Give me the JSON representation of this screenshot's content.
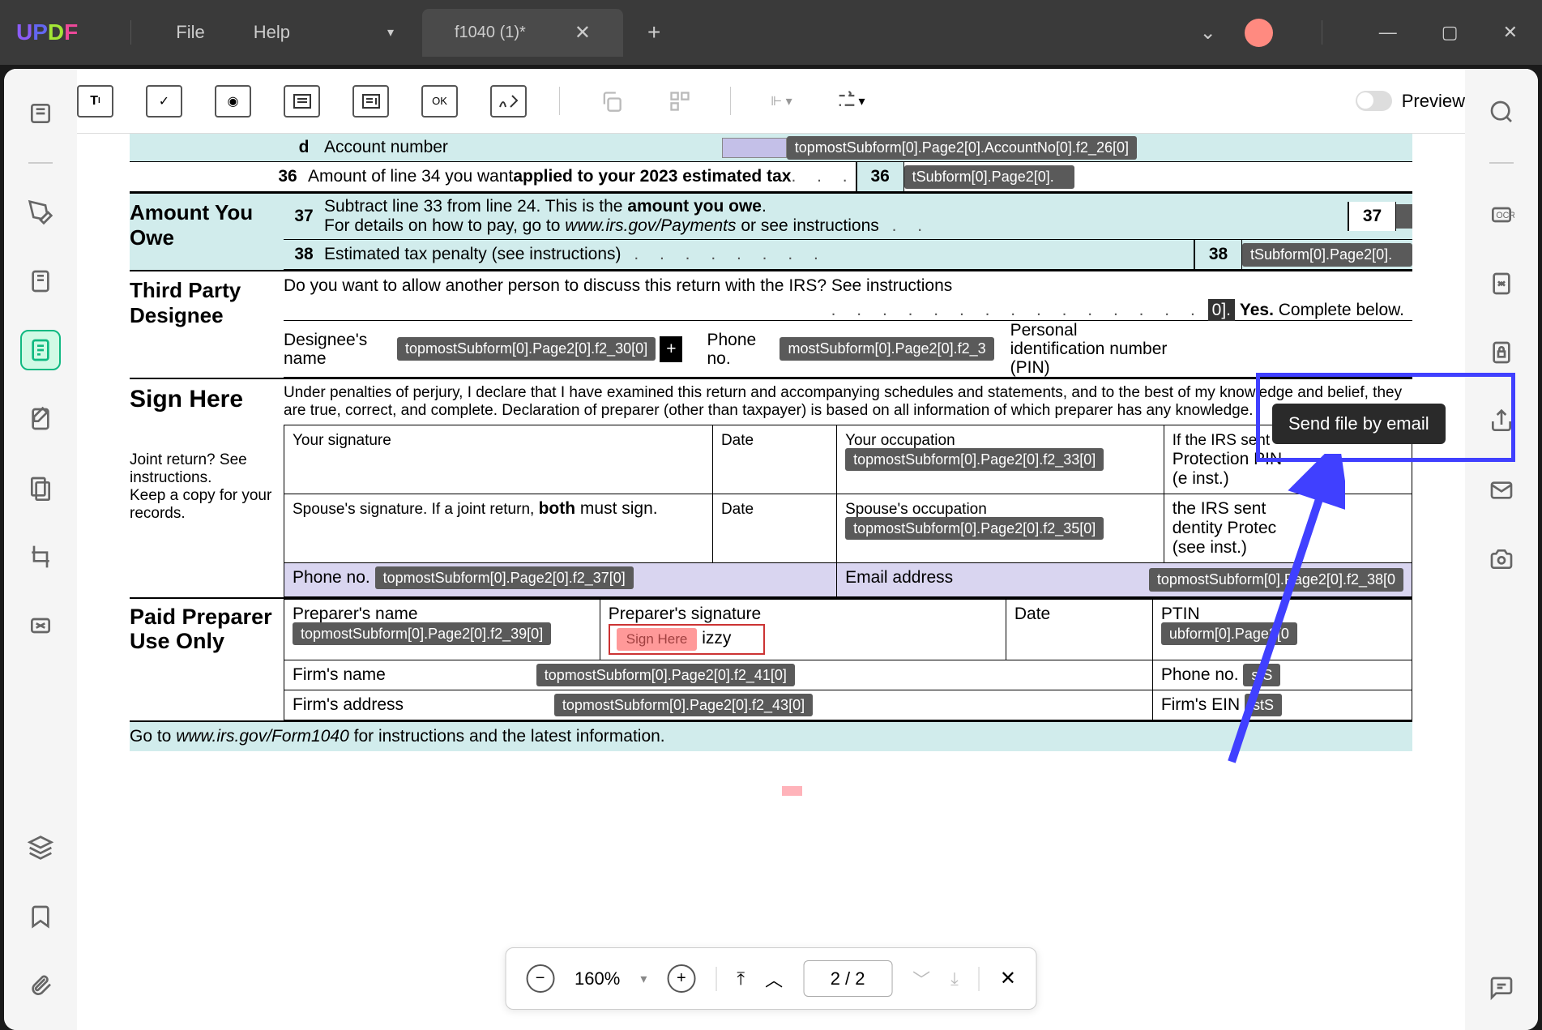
{
  "titlebar": {
    "menu_file": "File",
    "menu_help": "Help",
    "tab_title": "f1040 (1)*"
  },
  "toolbar": {
    "preview_label": "Preview",
    "ok_label": "OK",
    "text_label": "T"
  },
  "tooltip": {
    "send_email": "Send file by email"
  },
  "form": {
    "line_d": "d",
    "account_number": "Account number",
    "account_field": "topmostSubform[0].Page2[0].AccountNo[0].f2_26[0]",
    "line_36": "36",
    "line_36_text": "Amount of line 34 you want ",
    "line_36_bold": "applied to your 2023 estimated tax",
    "line_36_field": "tSubform[0].Page2[0].",
    "amount_you_owe": "Amount You Owe",
    "line_37": "37",
    "line_37_a": "Subtract line 33 from line 24. This is the ",
    "line_37_bold": "amount you owe",
    "line_37_b": ".",
    "line_37_c": "For details on how to pay, go to ",
    "line_37_url": "www.irs.gov/Payments",
    "line_37_d": " or see instructions",
    "line_38": "38",
    "line_38_text": "Estimated tax penalty (see instructions)",
    "line_38_field": "tSubform[0].Page2[0].",
    "third_party": "Third Party Designee",
    "third_party_q": "Do you want to allow another person to discuss this return with the IRS? See instructions",
    "yes_label": "Yes.",
    "complete_below": " Complete below.",
    "designee_name": "Designee's name",
    "designee_field": "topmostSubform[0].Page2[0].f2_30[0]",
    "phone_no": "Phone no.",
    "phone_field": "mostSubform[0].Page2[0].f2_3",
    "pin_label": "Personal identification number (PIN)",
    "sign_here": "Sign Here",
    "perjury": "Under penalties of perjury, I declare that I have examined this return and accompanying schedules and statements, and to the best of my knowledge and belief, they are true, correct, and complete. Declaration of preparer (other than taxpayer) is based on all information of which preparer has any knowledge.",
    "joint_return": "Joint return? See instructions.",
    "keep_copy": "Keep a copy for your records.",
    "your_sig": "Your signature",
    "date_label": "Date",
    "occupation": "Your occupation",
    "occupation_field": "topmostSubform[0].Page2[0].f2_33[0]",
    "irs_pin": "If the IRS sent you an Identity Protection PIN, enter it here (see inst.)",
    "irs_pin_short1": "If the IRS sent",
    "irs_pin_short2": "Protection PIN",
    "irs_pin_short3": "e inst.)",
    "spouse_sig": "Spouse's signature. If a joint return, ",
    "both": "both",
    "must_sign": " must sign.",
    "spouse_occ": "Spouse's occupation",
    "spouse_occ_field": "topmostSubform[0].Page2[0].f2_35[0]",
    "spouse_pin1": "the IRS sent",
    "spouse_pin2": "dentity Protec",
    "spouse_pin3": "(see inst.)",
    "phone_label": "Phone no.",
    "phone_field2": "topmostSubform[0].Page2[0].f2_37[0]",
    "email_label": "Email address",
    "email_field": "topmostSubform[0].Page2[0].f2_38[0",
    "paid_preparer": "Paid Preparer Use Only",
    "prep_name": "Preparer's name",
    "prep_name_field": "topmostSubform[0].Page2[0].f2_39[0]",
    "prep_sig": "Preparer's signature",
    "sign_here_tag": "Sign Here",
    "izzy": "izzy",
    "ptin": "PTIN",
    "ptin_field": "ubform[0].Page2[0",
    "firm_name": "Firm's name",
    "firm_name_field": "topmostSubform[0].Page2[0].f2_41[0]",
    "firm_phone": "Phone no.",
    "firm_phone_field": "stS",
    "firm_addr": "Firm's address",
    "firm_addr_field": "topmostSubform[0].Page2[0].f2_43[0]",
    "firm_ein": "Firm's EIN",
    "firm_ein_field": "stS",
    "footer_a": "Go to ",
    "footer_url": "www.irs.gov/Form1040",
    "footer_b": " for instructions and the latest information."
  },
  "bottom": {
    "zoom": "160%",
    "page": "2 / 2"
  }
}
